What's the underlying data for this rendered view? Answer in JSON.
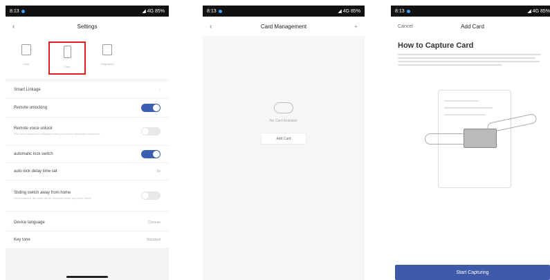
{
  "status": {
    "time": "8:13",
    "right": "◢ 4G 85%"
  },
  "screen1": {
    "title": "Settings",
    "tabs": [
      {
        "label": "Lock"
      },
      {
        "label": "Card"
      },
      {
        "label": "Fingerprint"
      }
    ],
    "rows": {
      "smart_linkage": "Smart Linkage",
      "remote_unlocking": "Remote unlocking",
      "remote_voice_unlock": "Remote voice unlock",
      "remote_voice_sub": "The voice password verification uses your phone bluetooth connection",
      "automatic_lock_switch": "automatic lock switch",
      "auto_lock_delay": "auto lock delay time set",
      "auto_lock_delay_value": "5s",
      "sliding_switch": "Sliding switch away from home",
      "sliding_switch_sub": "Once enabled, all doors will be unlocked when you leave home",
      "device_language": "Device language",
      "device_language_value": "Chinese",
      "key_tone": "Key tone",
      "key_tone_value": "Standard"
    },
    "toggles": {
      "remote_unlocking": true,
      "remote_voice_unlock": false,
      "automatic_lock_switch": true,
      "sliding_switch": false
    }
  },
  "screen2": {
    "title": "Card Management",
    "more": "+",
    "empty_text": "No Card Available",
    "add_card": "Add Card"
  },
  "screen3": {
    "cancel": "Cancel",
    "title": "Add Card",
    "heading": "How to Capture Card",
    "start_button": "Start Capturing"
  }
}
